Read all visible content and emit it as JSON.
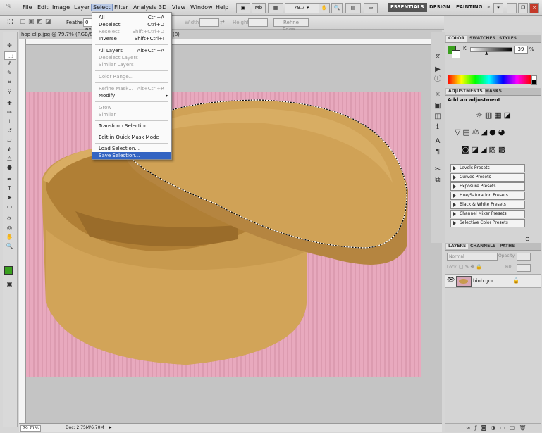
{
  "app": {
    "logo": "Ps"
  },
  "menubar": {
    "items": [
      "File",
      "Edit",
      "Image",
      "Layer",
      "Select",
      "Filter",
      "Analysis",
      "3D",
      "View",
      "Window",
      "Help"
    ],
    "zoom": "79.7",
    "workspaces": [
      "ESSENTIALS",
      "DESIGN",
      "PAINTING"
    ]
  },
  "options": {
    "feather_label": "Feather:",
    "feather_value": "0 px",
    "width_label": "Width:",
    "height_label": "Height:",
    "refine_edge": "Refine Edge..."
  },
  "document": {
    "title": "hop elip.jpg @ 79.7% (RGB/8)",
    "title_suffix": "(8)",
    "status_zoom": "79.71%",
    "doc_size": "Doc: 2.75M/6.70M"
  },
  "select_menu": {
    "items": [
      {
        "label": "All",
        "shortcut": "Ctrl+A",
        "disabled": false
      },
      {
        "label": "Deselect",
        "shortcut": "Ctrl+D",
        "disabled": false
      },
      {
        "label": "Reselect",
        "shortcut": "Shift+Ctrl+D",
        "disabled": true
      },
      {
        "label": "Inverse",
        "shortcut": "Shift+Ctrl+I",
        "disabled": false
      },
      {
        "label": "All Layers",
        "shortcut": "Alt+Ctrl+A",
        "disabled": false
      },
      {
        "label": "Deselect Layers",
        "shortcut": "",
        "disabled": true
      },
      {
        "label": "Similar Layers",
        "shortcut": "",
        "disabled": true
      },
      {
        "label": "Color Range...",
        "shortcut": "",
        "disabled": true
      },
      {
        "label": "Refine Mask...",
        "shortcut": "Alt+Ctrl+R",
        "disabled": true
      },
      {
        "label": "Modify",
        "shortcut": "▸",
        "disabled": false
      },
      {
        "label": "Grow",
        "shortcut": "",
        "disabled": true
      },
      {
        "label": "Similar",
        "shortcut": "",
        "disabled": true
      },
      {
        "label": "Transform Selection",
        "shortcut": "",
        "disabled": false
      },
      {
        "label": "Edit in Quick Mask Mode",
        "shortcut": "",
        "disabled": false
      },
      {
        "label": "Load Selection...",
        "shortcut": "",
        "disabled": false
      },
      {
        "label": "Save Selection...",
        "shortcut": "",
        "disabled": false
      }
    ]
  },
  "color_panel": {
    "tabs": [
      "COLOR",
      "SWATCHES",
      "STYLES"
    ],
    "channel": "K",
    "value": "39",
    "unit": "%",
    "fg_color": "#3aa01e",
    "bg_color": "#ffffff"
  },
  "adjustments_panel": {
    "tabs": [
      "ADJUSTMENTS",
      "MASKS"
    ],
    "heading": "Add an adjustment",
    "presets": [
      "Levels Presets",
      "Curves Presets",
      "Exposure Presets",
      "Hue/Saturation Presets",
      "Black & White Presets",
      "Channel Mixer Presets",
      "Selective Color Presets"
    ]
  },
  "layers_panel": {
    "tabs": [
      "LAYERS",
      "CHANNELS",
      "PATHS"
    ],
    "blend_mode": "Normal",
    "opacity_label": "Opacity:",
    "lock_label": "Lock:",
    "fill_label": "Fill:",
    "layer_name": "hinh goc"
  }
}
